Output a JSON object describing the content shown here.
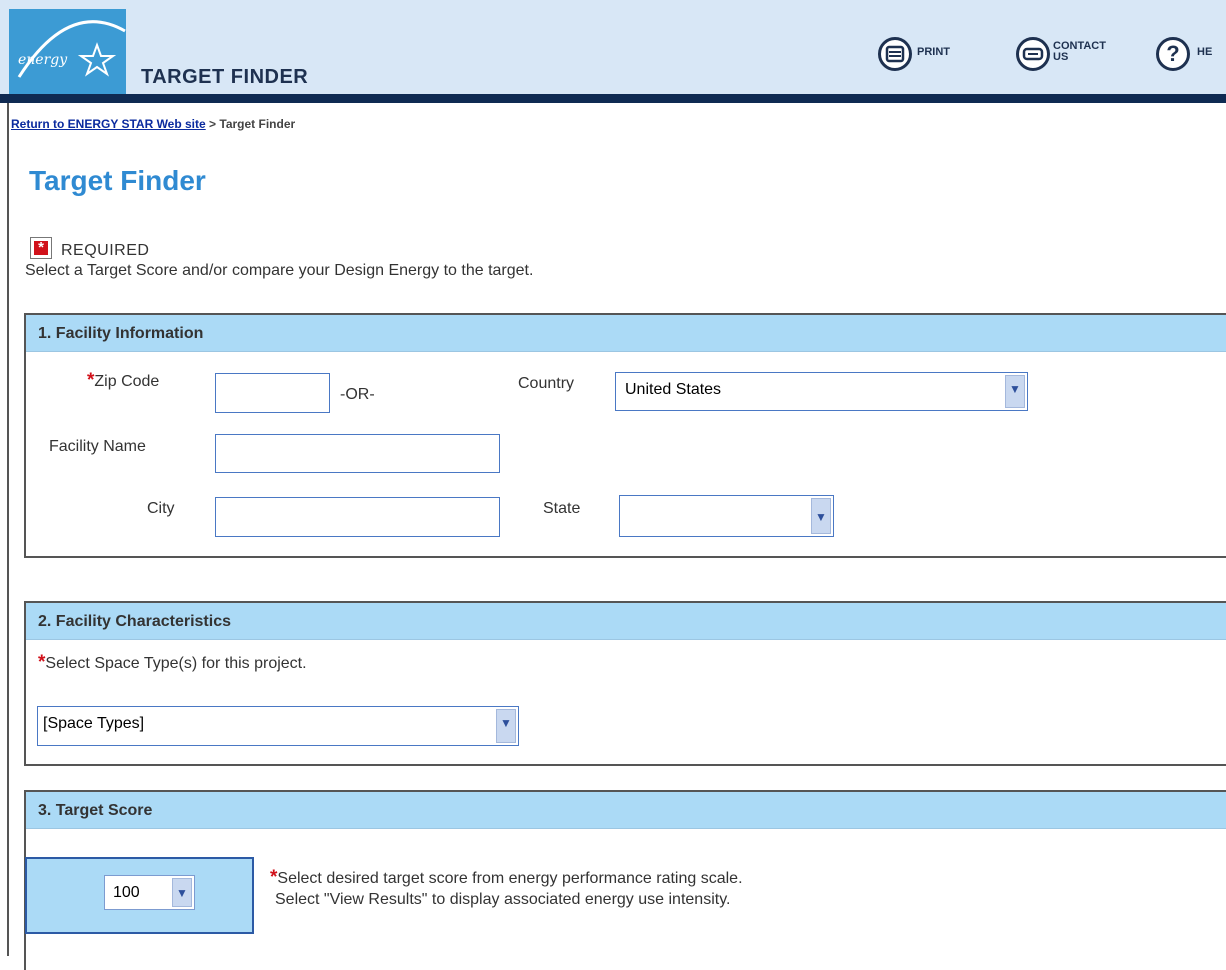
{
  "header": {
    "logo_text": "energy",
    "title": "TARGET FINDER",
    "print_label": "PRINT",
    "contact_label_1": "CONTACT",
    "contact_label_2": "US",
    "help_label": "HE"
  },
  "breadcrumb": {
    "link": "Return to ENERGY STAR Web site",
    "separator": " > ",
    "current": "Target Finder"
  },
  "page_title": "Target Finder",
  "required": {
    "icon_glyph": "*",
    "label": "REQUIRED",
    "instructions": "Select a Target Score and/or compare your Design Energy to the target."
  },
  "section1": {
    "title": "1. Facility Information",
    "zip_label": "Zip Code",
    "or_label": "-OR-",
    "country_label": "Country",
    "country_value": "United States",
    "facility_name_label": "Facility Name",
    "city_label": "City",
    "state_label": "State",
    "state_value": ""
  },
  "section2": {
    "title": "2. Facility Characteristics",
    "prompt": "Select Space Type(s) for this project.",
    "space_type_value": "[Space Types]"
  },
  "section3": {
    "title": "3. Target Score",
    "score_value": "100",
    "line1": "Select desired target score from energy performance rating scale.",
    "line2": "Select \"View Results\" to display associated energy use intensity."
  },
  "common": {
    "required_star": "*",
    "dropdown_glyph": "▼"
  },
  "colors": {
    "header_bg": "#d8e7f6",
    "header_rule": "#0f2a52",
    "logo_bg": "#3c9bd4",
    "section_header_bg": "#abdaf6",
    "title_blue": "#2f8ad2",
    "required_red": "#d1111a"
  }
}
